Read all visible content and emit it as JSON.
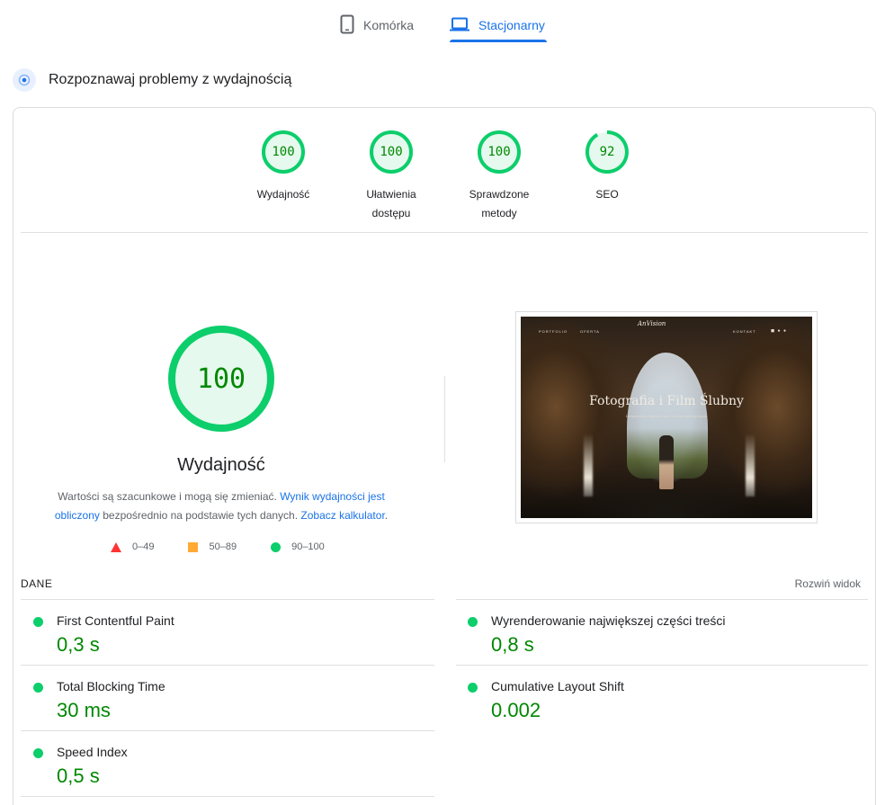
{
  "tabs": {
    "mobile": "Komórka",
    "desktop": "Stacjonarny"
  },
  "section": {
    "title": "Rozpoznawaj problemy z wydajnością"
  },
  "categories": [
    {
      "score": "100",
      "label": "Wydajność"
    },
    {
      "score": "100",
      "label": "Ułatwienia dostępu"
    },
    {
      "score": "100",
      "label": "Sprawdzone metody"
    },
    {
      "score": "92",
      "label": "SEO"
    }
  ],
  "performance": {
    "score": "100",
    "title": "Wydajność",
    "note_before": "Wartości są szacunkowe i mogą się zmieniać. ",
    "note_link1": "Wynik wydajności jest obliczony",
    "note_middle": " bezpośrednio na podstawie tych danych. ",
    "note_link2": "Zobacz kalkulator",
    "note_after": "."
  },
  "legend": {
    "fail": "0–49",
    "average": "50–89",
    "pass": "90–100"
  },
  "screenshot": {
    "nav_left1": "PORTFOLIO",
    "nav_left2": "OFERTA",
    "logo": "AnVision",
    "nav_right": "KONTAKT",
    "headline": "Fotografia i Film Ślubny",
    "subline": "Uwieczniamy najpiękniejsze chwile Waszego życia"
  },
  "data": {
    "heading": "DANE",
    "expand_label": "Rozwiń widok",
    "metrics": [
      {
        "label": "First Contentful Paint",
        "value": "0,3 s"
      },
      {
        "label": "Wyrenderowanie największej części treści",
        "value": "0,8 s"
      },
      {
        "label": "Total Blocking Time",
        "value": "30 ms"
      },
      {
        "label": "Cumulative Layout Shift",
        "value": "0.002"
      },
      {
        "label": "Speed Index",
        "value": "0,5 s"
      }
    ]
  },
  "colors": {
    "pass": "#0cce6b",
    "pass_text": "#008800",
    "average": "#ffaa33",
    "fail": "#ff3333",
    "accent": "#1a73e8"
  }
}
